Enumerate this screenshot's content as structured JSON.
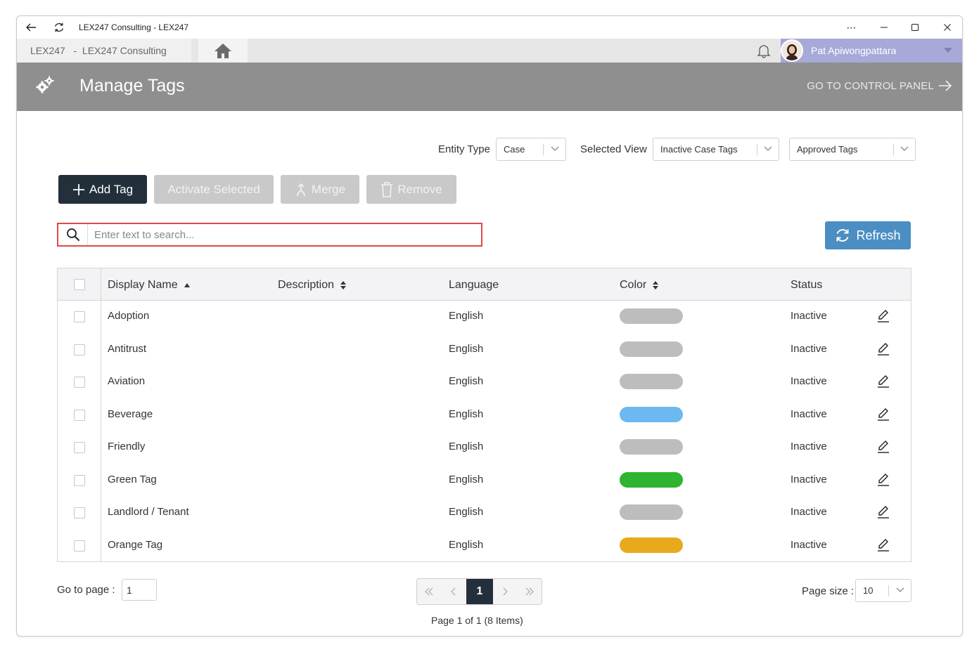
{
  "window": {
    "title": "LEX247 Consulting - LEX247"
  },
  "tabstrip": {
    "tab_label": "LEX247   -  LEX247 Consulting",
    "user_name": "Pat Apiwongpattara"
  },
  "header": {
    "title": "Manage Tags",
    "control_panel_label": "GO TO CONTROL PANEL"
  },
  "filters": {
    "entity_type_label": "Entity Type",
    "entity_type_value": "Case",
    "selected_view_label": "Selected View",
    "selected_view_value": "Inactive Case Tags",
    "approval_value": "Approved Tags"
  },
  "toolbar": {
    "add_tag": "Add Tag",
    "activate_selected": "Activate Selected",
    "merge": "Merge",
    "remove": "Remove",
    "refresh": "Refresh"
  },
  "search": {
    "placeholder": "Enter text to search..."
  },
  "table": {
    "columns": [
      "Display Name",
      "Description",
      "Language",
      "Color",
      "Status"
    ],
    "rows": [
      {
        "name": "Adoption",
        "description": "",
        "language": "English",
        "color": "#bdbdbd",
        "status": "Inactive"
      },
      {
        "name": "Antitrust",
        "description": "",
        "language": "English",
        "color": "#bdbdbd",
        "status": "Inactive"
      },
      {
        "name": "Aviation",
        "description": "",
        "language": "English",
        "color": "#bdbdbd",
        "status": "Inactive"
      },
      {
        "name": "Beverage",
        "description": "",
        "language": "English",
        "color": "#6cb8f0",
        "status": "Inactive"
      },
      {
        "name": "Friendly",
        "description": "",
        "language": "English",
        "color": "#bdbdbd",
        "status": "Inactive"
      },
      {
        "name": "Green Tag",
        "description": "",
        "language": "English",
        "color": "#2fb42f",
        "status": "Inactive"
      },
      {
        "name": "Landlord / Tenant",
        "description": "",
        "language": "English",
        "color": "#bdbdbd",
        "status": "Inactive"
      },
      {
        "name": "Orange Tag",
        "description": "",
        "language": "English",
        "color": "#e8a91c",
        "status": "Inactive"
      }
    ]
  },
  "pagination": {
    "goto_label": "Go to page :",
    "goto_value": "1",
    "current_page": "1",
    "info": "Page 1 of 1 (8 Items)",
    "page_size_label": "Page size :",
    "page_size_value": "10"
  },
  "colors": {
    "header_bg": "#8f8f8f",
    "primary_dark": "#23303c",
    "refresh_blue": "#4a8ec3",
    "search_border": "#e0474c",
    "user_area": "#a7a9d9"
  }
}
